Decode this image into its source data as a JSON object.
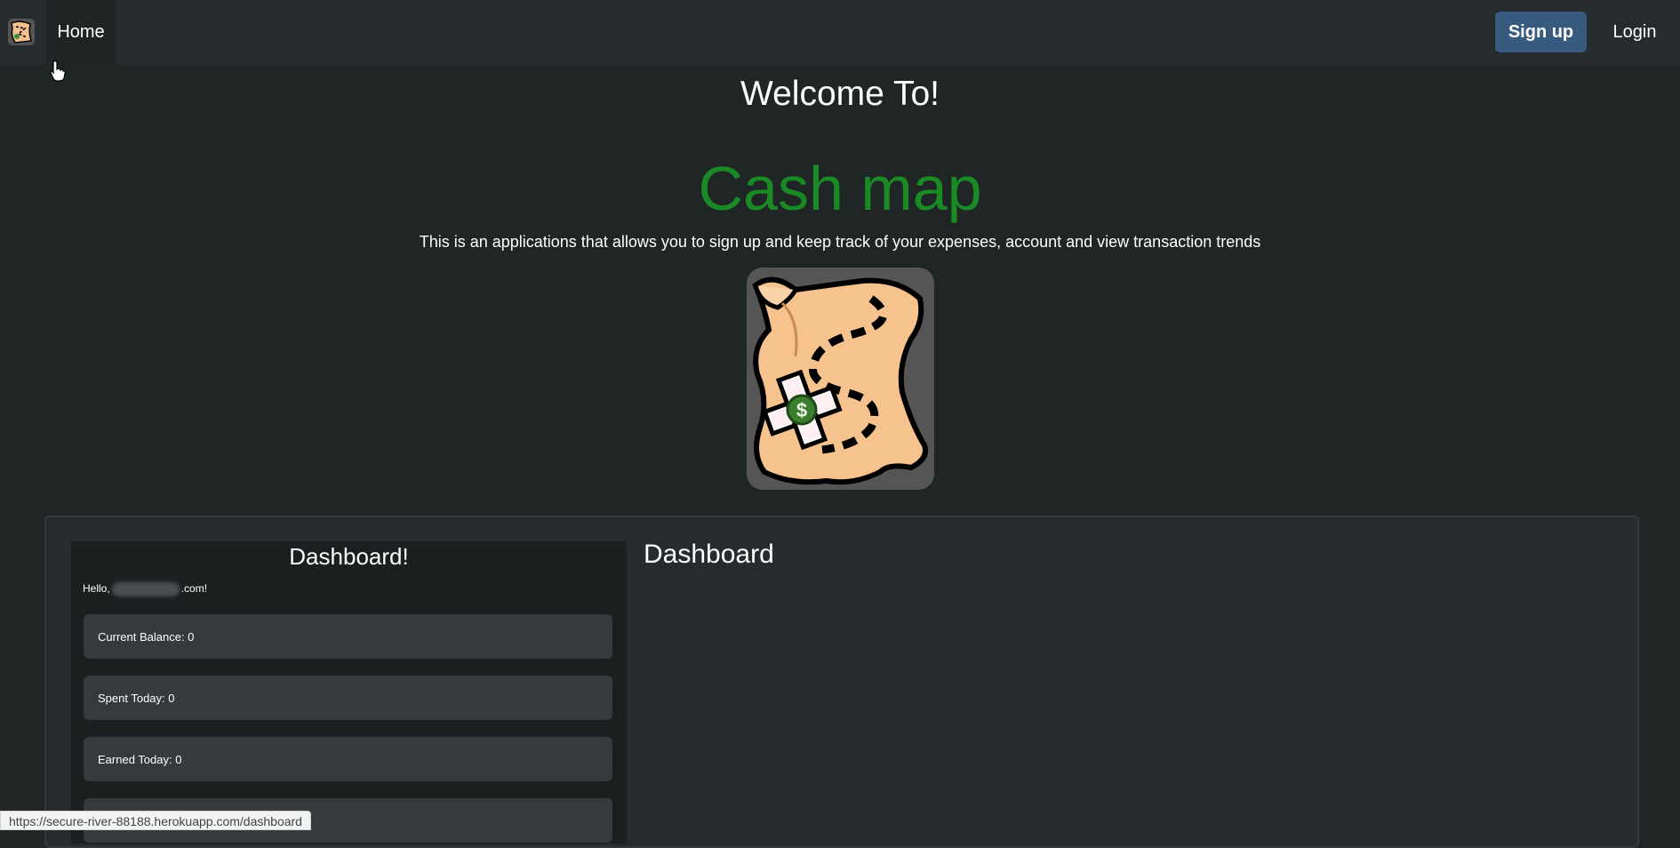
{
  "navbar": {
    "home_label": "Home",
    "signup_label": "Sign up",
    "login_label": "Login"
  },
  "hero": {
    "welcome": "Welcome To!",
    "app_name": "Cash map",
    "description": "This is an applications that allows you to sign up and keep track of your expenses, account and view transaction trends"
  },
  "preview": {
    "title": "Dashboard!",
    "hello_prefix": "Hello,",
    "hello_suffix": ".com!",
    "stats": [
      {
        "label": "Current Balance: 0"
      },
      {
        "label": "Spent Today: 0"
      },
      {
        "label": "Earned Today: 0"
      }
    ]
  },
  "section": {
    "heading": "Dashboard"
  },
  "status_bar": {
    "url": "https://secure-river-88188.herokuapp.com/dashboard"
  },
  "colors": {
    "background": "#202526",
    "navbar": "#262c2e",
    "accent_button": "#375a7f",
    "brand_green": "#1a8a24"
  },
  "icons": {
    "brand": "cash-map-logo-icon",
    "cursor": "hand-pointer-icon"
  }
}
